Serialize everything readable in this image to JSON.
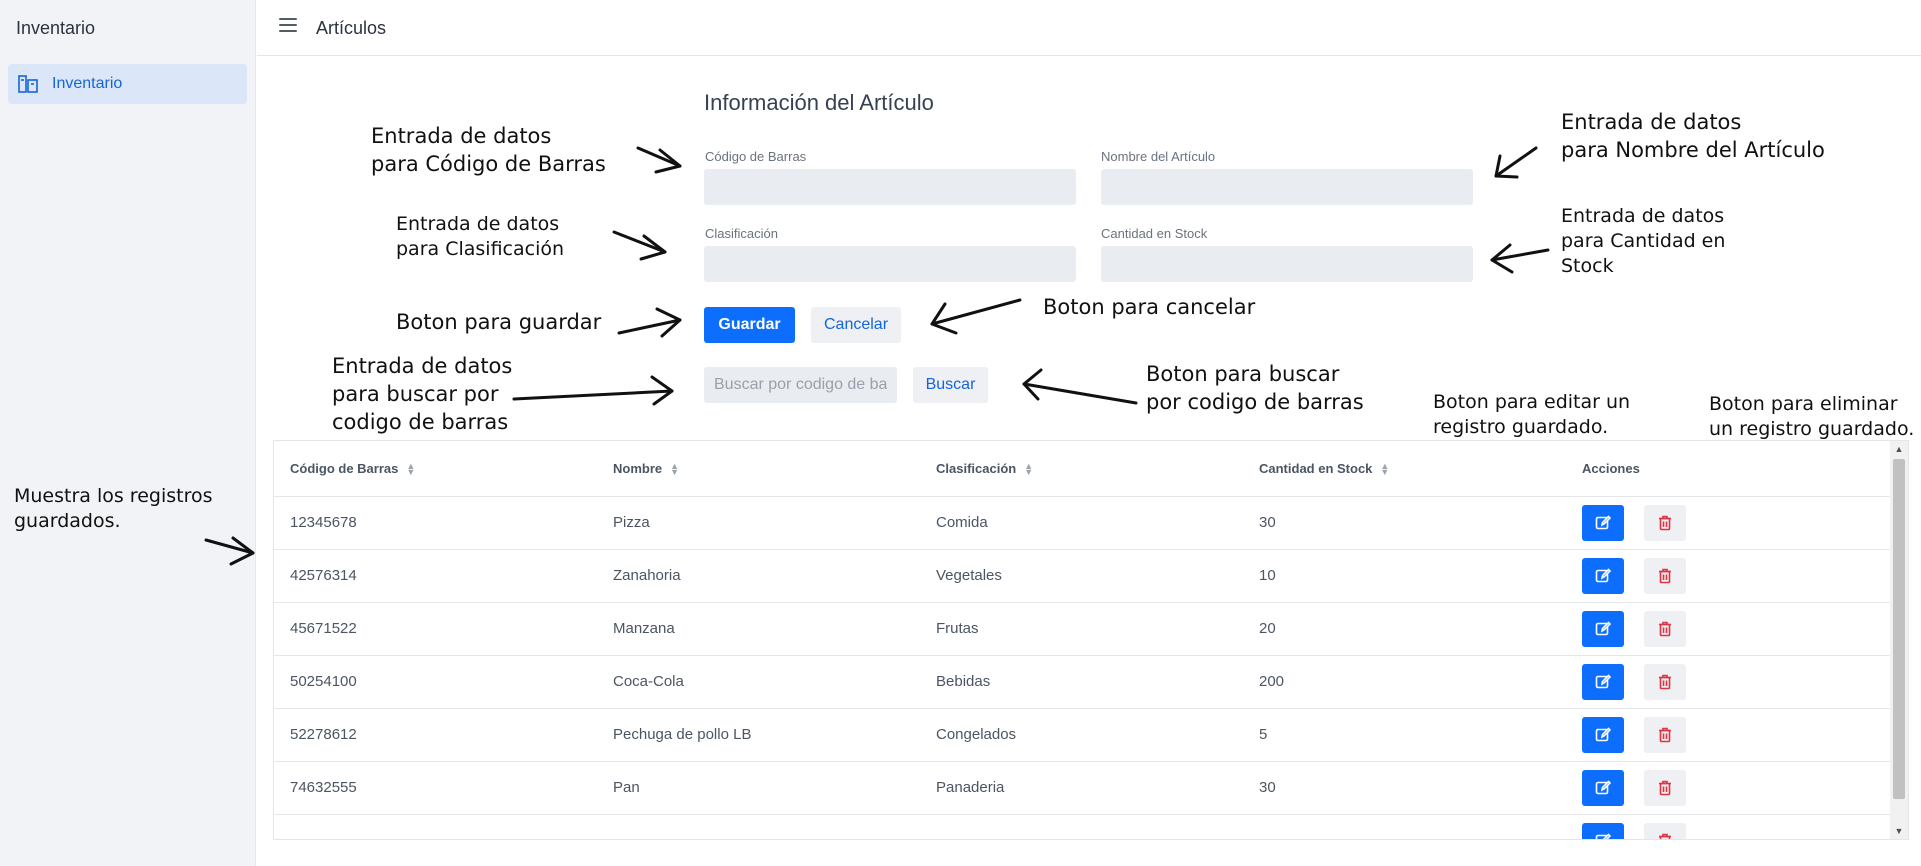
{
  "sidebar": {
    "title": "Inventario",
    "items": [
      {
        "label": "Inventario",
        "icon": "inventory-icon",
        "active": true
      }
    ]
  },
  "topbar": {
    "title": "Artículos",
    "menu_icon": "hamburger-icon"
  },
  "form": {
    "title": "Información del Artículo",
    "barcode_label": "Código de Barras",
    "name_label": "Nombre del Artículo",
    "class_label": "Clasificación",
    "stock_label": "Cantidad en Stock",
    "save_label": "Guardar",
    "cancel_label": "Cancelar",
    "search_placeholder": "Buscar por codigo de barras",
    "search_label": "Buscar"
  },
  "table": {
    "headers": [
      "Código de Barras",
      "Nombre",
      "Clasificación",
      "Cantidad en Stock",
      "Acciones"
    ],
    "rows": [
      {
        "code": "12345678",
        "name": "Pizza",
        "class": "Comida",
        "stock": "30"
      },
      {
        "code": "42576314",
        "name": "Zanahoria",
        "class": "Vegetales",
        "stock": "10"
      },
      {
        "code": "45671522",
        "name": "Manzana",
        "class": "Frutas",
        "stock": "20"
      },
      {
        "code": "50254100",
        "name": "Coca-Cola",
        "class": "Bebidas",
        "stock": "200"
      },
      {
        "code": "52278612",
        "name": "Pechuga de pollo LB",
        "class": "Congelados",
        "stock": "5"
      },
      {
        "code": "74632555",
        "name": "Pan",
        "class": "Panaderia",
        "stock": "30"
      }
    ]
  },
  "annotations": {
    "barcode": "Entrada de datos\npara Código de Barras",
    "name": "Entrada de datos\npara Nombre del Artículo",
    "class": "Entrada de datos\n para Clasificación",
    "stock": "Entrada de datos\npara Cantidad en\nStock",
    "save": "Boton para guardar",
    "cancel": "Boton para cancelar",
    "search_input": "Entrada de datos\npara buscar por\ncodigo de barras",
    "search_button": "Boton para buscar\npor codigo de barras",
    "edit": "Boton para editar un\nregistro guardado.",
    "delete": "Boton para eliminar\nun registro guardado.",
    "records": "Muestra los registros\nguardados."
  },
  "colors": {
    "primary": "#0d6efd",
    "danger": "#dc3545",
    "sidebar_bg": "#f1f3f6",
    "active_item_bg": "#dbe7f8"
  }
}
